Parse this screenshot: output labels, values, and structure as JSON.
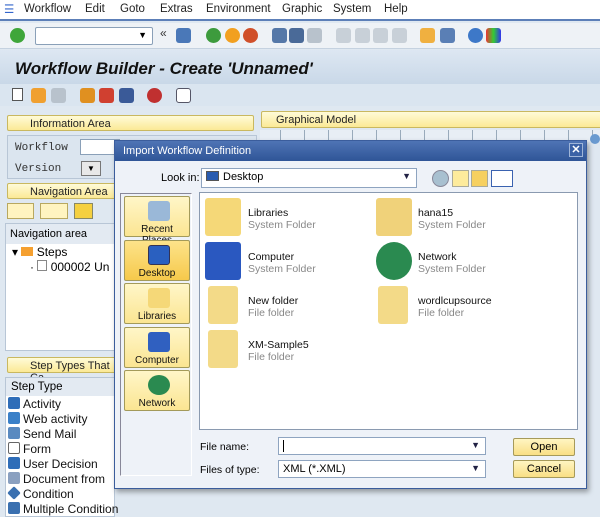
{
  "menu": [
    "Workflow",
    "Edit",
    "Goto",
    "Extras",
    "Environment",
    "Graphic",
    "System",
    "Help"
  ],
  "title": "Workflow Builder - Create 'Unnamed'",
  "info_area": {
    "header": "Information Area",
    "workflow_label": "Workflow",
    "version_label": "Version"
  },
  "nav_area": {
    "header": "Navigation Area",
    "table_header": "Navigation area",
    "steps_label": "Steps",
    "step_item": "000002 Un"
  },
  "step_types": {
    "header": "Step Types That Ca",
    "column": "Step Type",
    "items": [
      "Activity",
      "Web activity",
      "Send Mail",
      "Form",
      "User Decision",
      "Document from",
      "Condition",
      "Multiple Condition"
    ]
  },
  "graphical_model": {
    "header": "Graphical Model"
  },
  "dialog": {
    "title": "Import Workflow Definition",
    "look_in_label": "Look in:",
    "look_in_value": "Desktop",
    "places": [
      "Recent Places",
      "Desktop",
      "Libraries",
      "Computer",
      "Network"
    ],
    "selected_place": "Desktop",
    "files": [
      {
        "name": "Libraries",
        "type": "System Folder"
      },
      {
        "name": "hana15",
        "type": "System Folder"
      },
      {
        "name": "Computer",
        "type": "System Folder"
      },
      {
        "name": "Network",
        "type": "System Folder"
      },
      {
        "name": "New folder",
        "type": "File folder"
      },
      {
        "name": "wordlcupsource",
        "type": "File folder"
      },
      {
        "name": "XM-Sample5",
        "type": "File folder"
      }
    ],
    "file_name_label": "File name:",
    "file_name_value": "",
    "file_type_label": "Files of type:",
    "file_type_value": "XML (*.XML)",
    "open_label": "Open",
    "cancel_label": "Cancel"
  },
  "colors": {
    "header_yellow": "#fbe996",
    "dialog_title": "#2f5597",
    "menu_line": "#5c7fb8"
  }
}
